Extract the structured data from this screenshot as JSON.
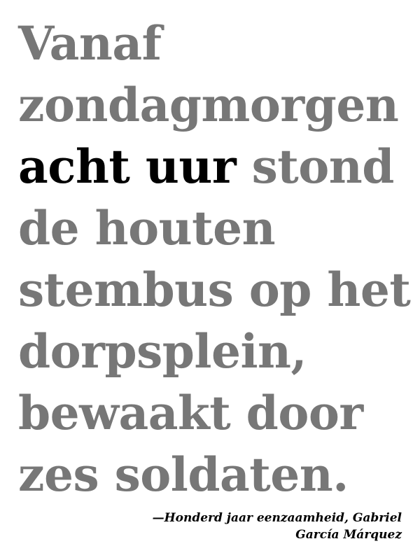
{
  "quote": {
    "lines": [
      {
        "text": "Vanaf"
      },
      {
        "text": "zondagmorgen"
      },
      {
        "highlight": "acht uur",
        "rest": " stond"
      },
      {
        "text": "de houten"
      },
      {
        "text": "stembus op het"
      },
      {
        "text": "dorpsplein,"
      },
      {
        "text": "bewaakt door"
      },
      {
        "text": "zes soldaten."
      }
    ]
  },
  "attribution": {
    "line1": "—Honderd jaar eenzaamheid, Gabriel",
    "line2": "García Márquez"
  },
  "colors": {
    "text": "#777777",
    "highlight": "#000000",
    "background": "#ffffff"
  }
}
